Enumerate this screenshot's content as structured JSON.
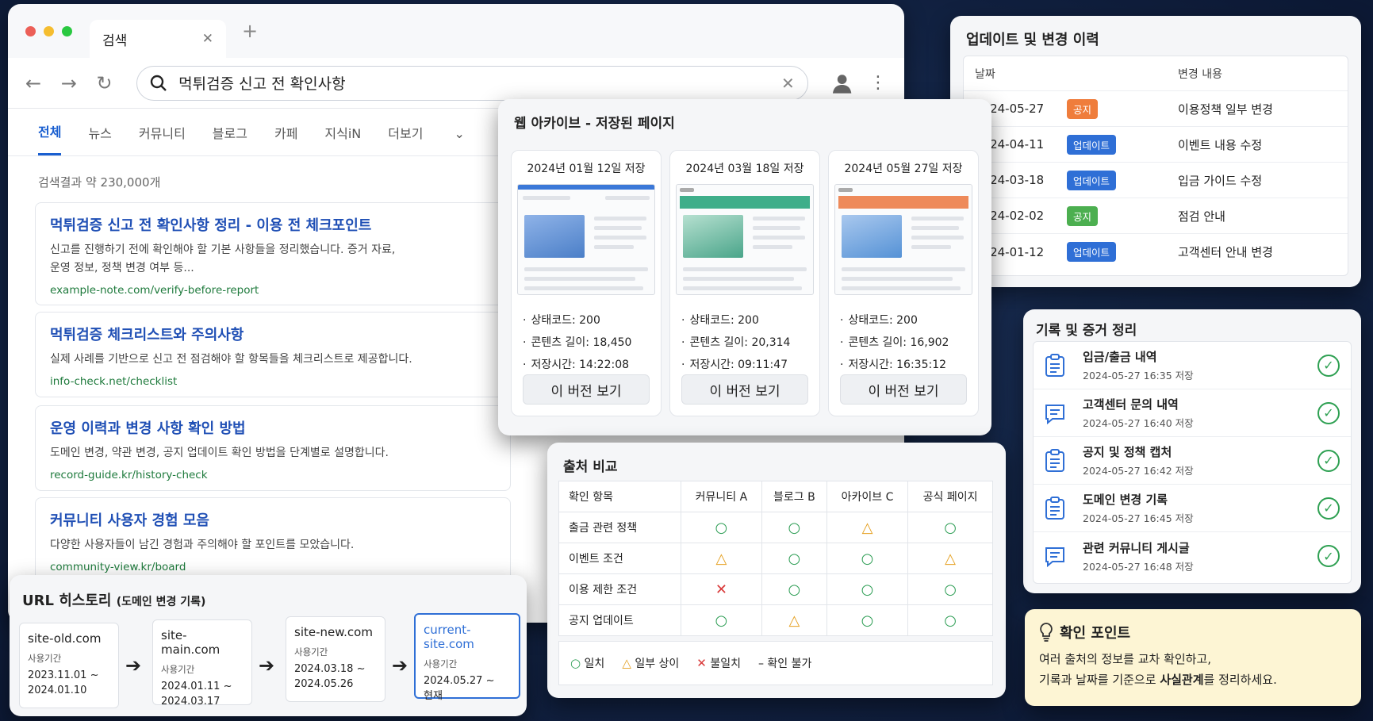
{
  "browser": {
    "tab_title": "검색",
    "query": "먹튀검증 신고 전 확인사항",
    "tabs": [
      "전체",
      "뉴스",
      "커뮤니티",
      "블로그",
      "카페",
      "지식iN",
      "더보기"
    ],
    "result_count": "검색결과 약 230,000개",
    "results": [
      {
        "title": "먹튀검증 신고 전 확인사항 정리 - 이용 전 체크포인트",
        "desc1": "신고를 진행하기 전에 확인해야 할 기본 사항들을 정리했습니다. 증거 자료,",
        "desc2": "운영 정보, 정책 변경 여부 등...",
        "url": "example-note.com/verify-before-report"
      },
      {
        "title": "먹튀검증 체크리스트와 주의사항",
        "desc1": "실제 사례를 기반으로 신고 전 점검해야 할 항목들을 체크리스트로 제공합니다.",
        "desc2": "",
        "url": "info-check.net/checklist"
      },
      {
        "title": "운영 이력과 변경 사항 확인 방법",
        "desc1": "도메인 변경, 약관 변경, 공지 업데이트 확인 방법을 단계별로 설명합니다.",
        "desc2": "",
        "url": "record-guide.kr/history-check"
      },
      {
        "title": "커뮤니티 사용자 경험 모음",
        "desc1": "다양한 사용자들이 남긴 경험과 주의해야 할 포인트를 모았습니다.",
        "desc2": "",
        "url": "community-view.kr/board"
      }
    ]
  },
  "archive": {
    "title": "웹 아카이브 - 저장된 페이지",
    "view_label": "이 버전 보기",
    "versions": [
      {
        "date": "2024년 01월 12일 저장",
        "status": "상태코드: 200",
        "length": "콘텐츠 길이: 18,450",
        "time": "저장시간: 14:22:08",
        "accent": "#3b78d8"
      },
      {
        "date": "2024년 03월 18일 저장",
        "status": "상태코드: 200",
        "length": "콘텐츠 길이: 20,314",
        "time": "저장시간: 09:11:47",
        "accent": "#3fae8a"
      },
      {
        "date": "2024년 05월 27일 저장",
        "status": "상태코드: 200",
        "length": "콘텐츠 길이: 16,902",
        "time": "저장시간: 16:35:12",
        "accent": "#ee8a5a"
      }
    ]
  },
  "history": {
    "title": "업데이트 및 변경 이력",
    "col_date": "날짜",
    "col_change": "변경 내용",
    "rows": [
      {
        "date": "2024-05-27",
        "badge": "공지",
        "badge_color": "#ef7d3c",
        "change": "이용정책 일부 변경"
      },
      {
        "date": "2024-04-11",
        "badge": "업데이트",
        "badge_color": "#2f6fd6",
        "change": "이벤트 내용 수정"
      },
      {
        "date": "2024-03-18",
        "badge": "업데이트",
        "badge_color": "#2f6fd6",
        "change": "입금 가이드 수정"
      },
      {
        "date": "2024-02-02",
        "badge": "공지",
        "badge_color": "#4caf50",
        "change": "점검 안내"
      },
      {
        "date": "2024-01-12",
        "badge": "업데이트",
        "badge_color": "#2f6fd6",
        "change": "고객센터 안내 변경"
      }
    ]
  },
  "evidence": {
    "title": "기록 및 증거 정리",
    "items": [
      {
        "name": "입금/출금 내역",
        "sub": "2024-05-27 16:35 저장",
        "icon": "clipboard-icon"
      },
      {
        "name": "고객센터 문의 내역",
        "sub": "2024-05-27 16:40 저장",
        "icon": "message-icon"
      },
      {
        "name": "공지 및 정책 캡처",
        "sub": "2024-05-27 16:42 저장",
        "icon": "clipboard-icon"
      },
      {
        "name": "도메인 변경 기록",
        "sub": "2024-05-27 16:45 저장",
        "icon": "clipboard-icon"
      },
      {
        "name": "관련 커뮤니티 게시글",
        "sub": "2024-05-27 16:48 저장",
        "icon": "message-icon"
      }
    ]
  },
  "compare": {
    "title": "출처 비교",
    "headers": [
      "확인 항목",
      "커뮤니티 A",
      "블로그 B",
      "아카이브 C",
      "공식 페이지"
    ],
    "rows": [
      {
        "label": "출금 관련 정책",
        "marks": [
          "o",
          "o",
          "t",
          "o"
        ]
      },
      {
        "label": "이벤트 조건",
        "marks": [
          "t",
          "o",
          "o",
          "t"
        ]
      },
      {
        "label": "이용 제한 조건",
        "marks": [
          "x",
          "o",
          "o",
          "o"
        ]
      },
      {
        "label": "공지 업데이트",
        "marks": [
          "o",
          "t",
          "o",
          "o"
        ]
      }
    ],
    "legend": {
      "match": "일치",
      "partial": "일부 상이",
      "mismatch": "불일치",
      "unknown": "확인 불가"
    }
  },
  "url_history": {
    "title": "URL 히스토리",
    "subtitle": "(도메인 변경 기록)",
    "period_label": "사용기간",
    "domains": [
      {
        "domain": "site-old.com",
        "from": "2023.11.01 ~",
        "to": "2024.01.10"
      },
      {
        "domain": "site-main.com",
        "from": "2024.01.11 ~",
        "to": "2024.03.17"
      },
      {
        "domain": "site-new.com",
        "from": "2024.03.18 ~",
        "to": "2024.05.26"
      },
      {
        "domain": "current-site.com",
        "from": "2024.05.27 ~",
        "to": "현재"
      }
    ]
  },
  "tip": {
    "title": "확인 포인트",
    "line1": "여러 출처의 정보를 교차 확인하고,",
    "line2_pre": "기록과 날짜를 기준으로 ",
    "line2_bold": "사실관계",
    "line2_post": "를 정리하세요."
  }
}
